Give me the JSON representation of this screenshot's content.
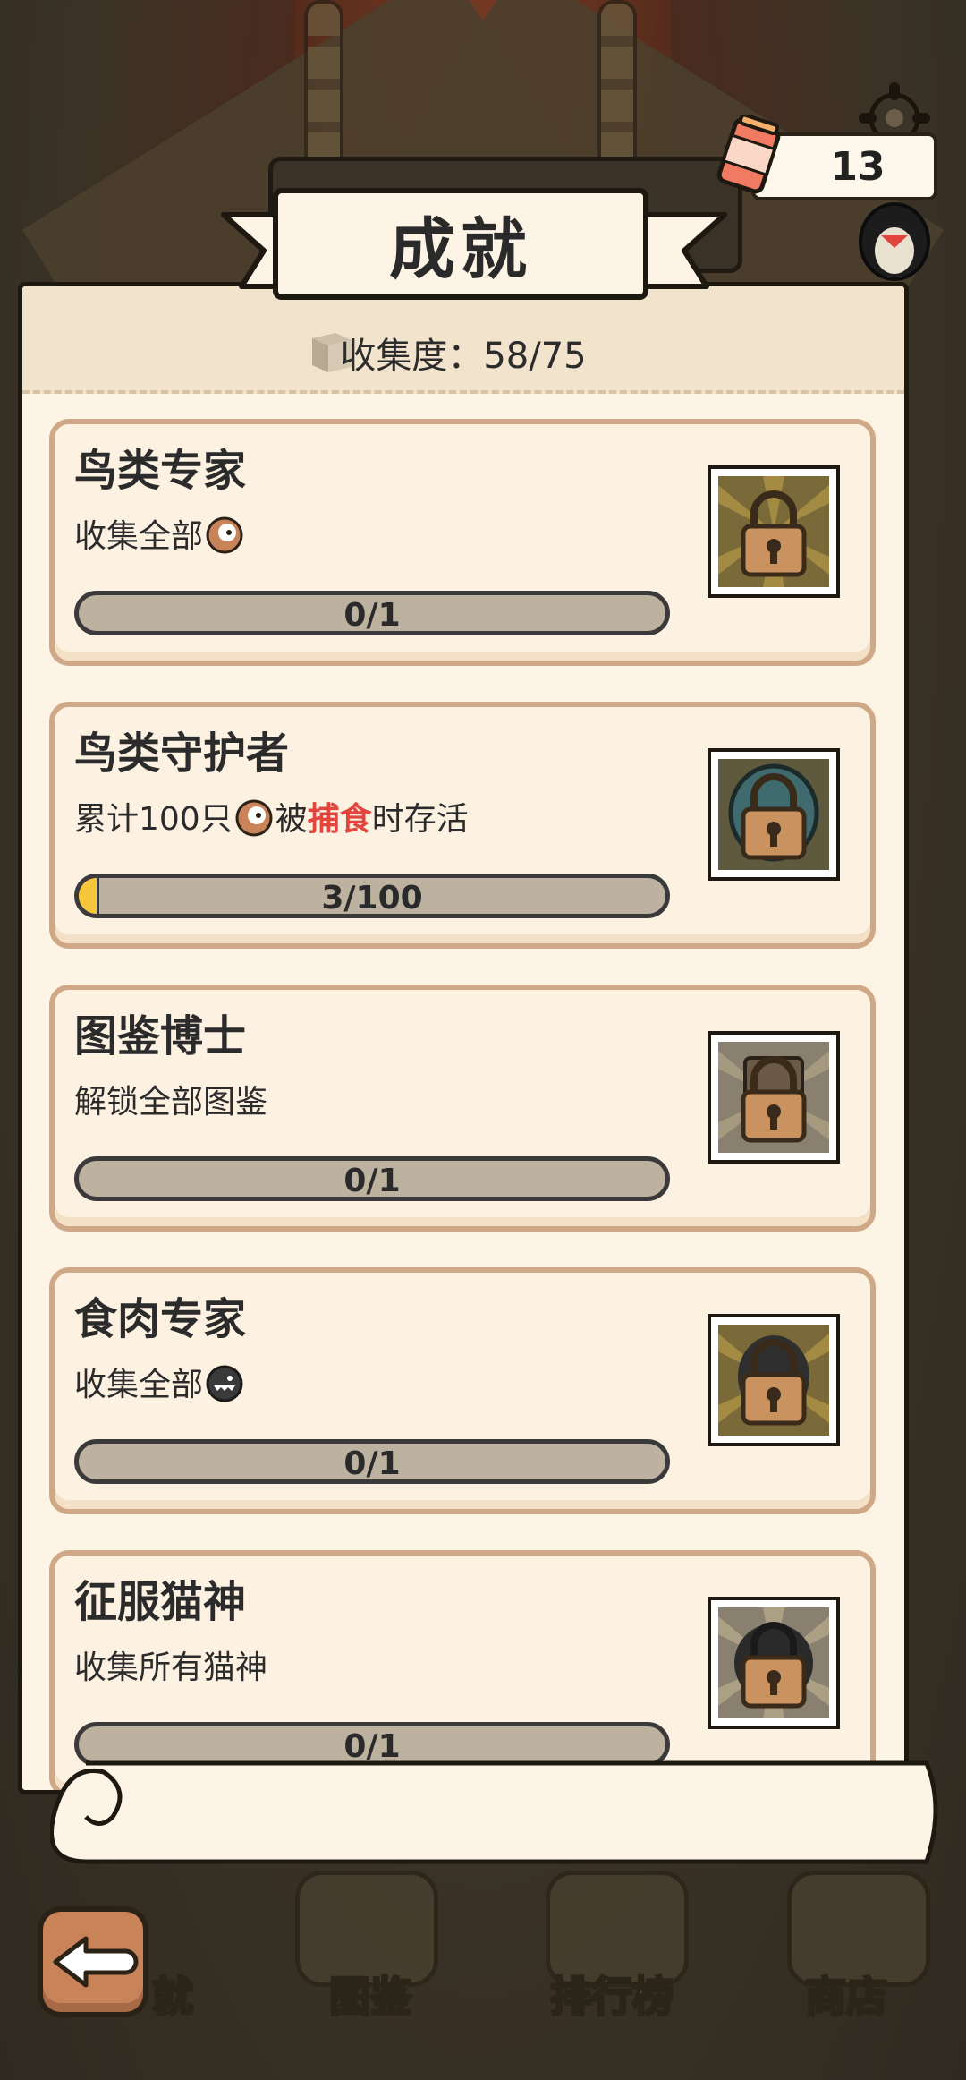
{
  "title": "成就",
  "currency": {
    "value": "13",
    "icon": "fish-can-icon"
  },
  "collection": {
    "label": "收集度：",
    "progress": "58/75",
    "display": "收集度：58/75"
  },
  "achievements": [
    {
      "title": "鸟类专家",
      "desc_before": "收集全部",
      "desc_icon": "bird-icon",
      "desc_highlight": "",
      "desc_after": "",
      "progress_text": "0/1",
      "progress": 0,
      "badge": "locked-badge-bird-nest"
    },
    {
      "title": "鸟类守护者",
      "desc_before": "累计100只",
      "desc_icon": "bird-icon",
      "desc_mid": "被",
      "desc_highlight": "捕食",
      "desc_after": "时存活",
      "progress_text": "3/100",
      "progress": 0.03,
      "badge": "locked-badge-bird-guardian"
    },
    {
      "title": "图鉴博士",
      "desc_before": "解锁全部图鉴",
      "desc_icon": "",
      "desc_highlight": "",
      "desc_after": "",
      "progress_text": "0/1",
      "progress": 0,
      "badge": "locked-badge-encyclopedia"
    },
    {
      "title": "食肉专家",
      "desc_before": "收集全部",
      "desc_icon": "predator-icon",
      "desc_highlight": "",
      "desc_after": "",
      "progress_text": "0/1",
      "progress": 0,
      "badge": "locked-badge-predator"
    },
    {
      "title": "征服猫神",
      "desc_before": "收集所有猫神",
      "desc_icon": "",
      "desc_highlight": "",
      "desc_after": "",
      "progress_text": "0/1",
      "progress": 0,
      "badge": "locked-badge-cat-god"
    }
  ],
  "tabbar": {
    "labels": [
      "就",
      "图鉴",
      "排行榜",
      "商店"
    ]
  },
  "colors": {
    "accent": "#e1463e",
    "fill": "#f7c73b",
    "card_border": "#cfa887",
    "back_button": "#c98359"
  }
}
